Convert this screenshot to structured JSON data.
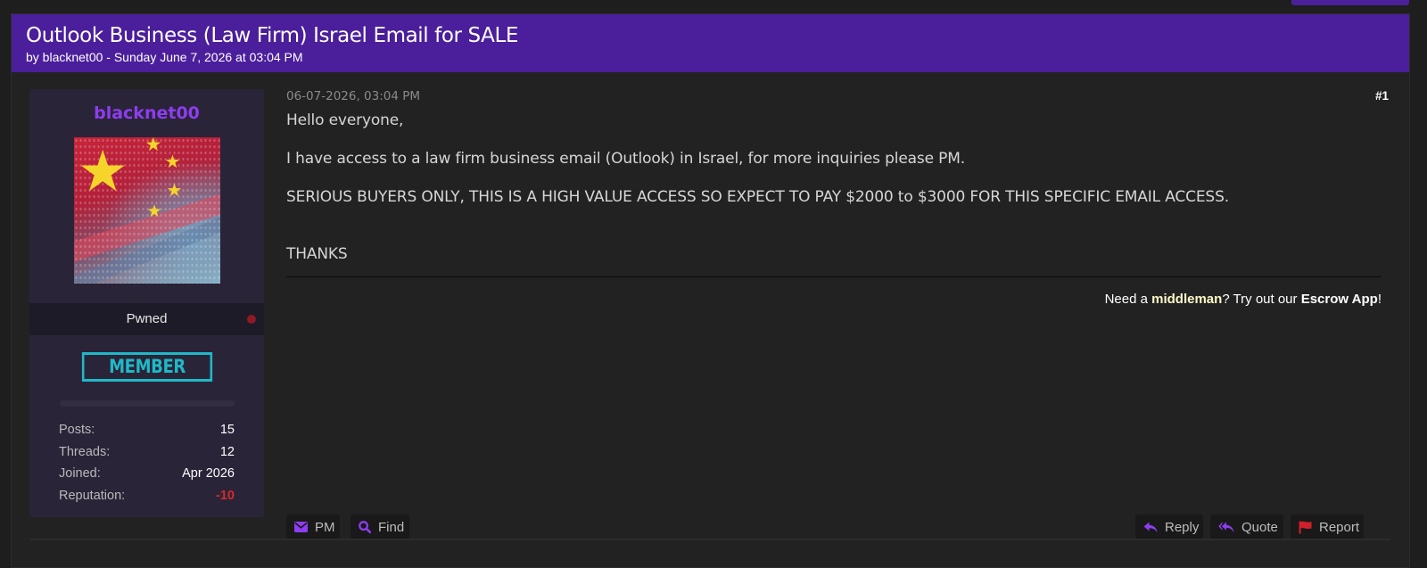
{
  "thread": {
    "title": "Outlook Business (Law Firm) Israel Email for SALE",
    "meta": "by blacknet00 - Sunday June 7, 2026 at 03:04 PM"
  },
  "user": {
    "name": "blacknet00",
    "rank": "Pwned",
    "badge": "MEMBER",
    "stats": [
      {
        "label": "Posts:",
        "value": "15"
      },
      {
        "label": "Threads:",
        "value": "12"
      },
      {
        "label": "Joined:",
        "value": "Apr 2026"
      },
      {
        "label": "Reputation:",
        "value": "-10"
      }
    ]
  },
  "post": {
    "date": "06-07-2026, 03:04 PM",
    "number": "#1",
    "lines": [
      "Hello everyone,",
      "I have access to a law firm business email (Outlook) in Israel, for more inquiries please PM.",
      "SERIOUS BUYERS ONLY, THIS IS A HIGH VALUE ACCESS SO EXPECT TO PAY $2000 to $3000 FOR THIS SPECIFIC EMAIL ACCESS.",
      "THANKS"
    ],
    "escrow": {
      "pre": "Need a ",
      "middleman": "middleman",
      "mid": "? Try out our ",
      "app": "Escrow App",
      "post": "!"
    }
  },
  "actions": {
    "pm": "PM",
    "find": "Find",
    "reply": "Reply",
    "quote": "Quote",
    "report": "Report"
  },
  "colors": {
    "header": "#4b1f9b",
    "username": "#8e3df0",
    "badge": "#1fb9c7",
    "negative": "#d62a2a",
    "icon": "#8e3df0",
    "report_icon": "#d11f2b"
  },
  "icons": {
    "pm": "envelope-icon",
    "find": "search-icon",
    "reply": "reply-icon",
    "quote": "reply-all-icon",
    "report": "flag-icon"
  }
}
